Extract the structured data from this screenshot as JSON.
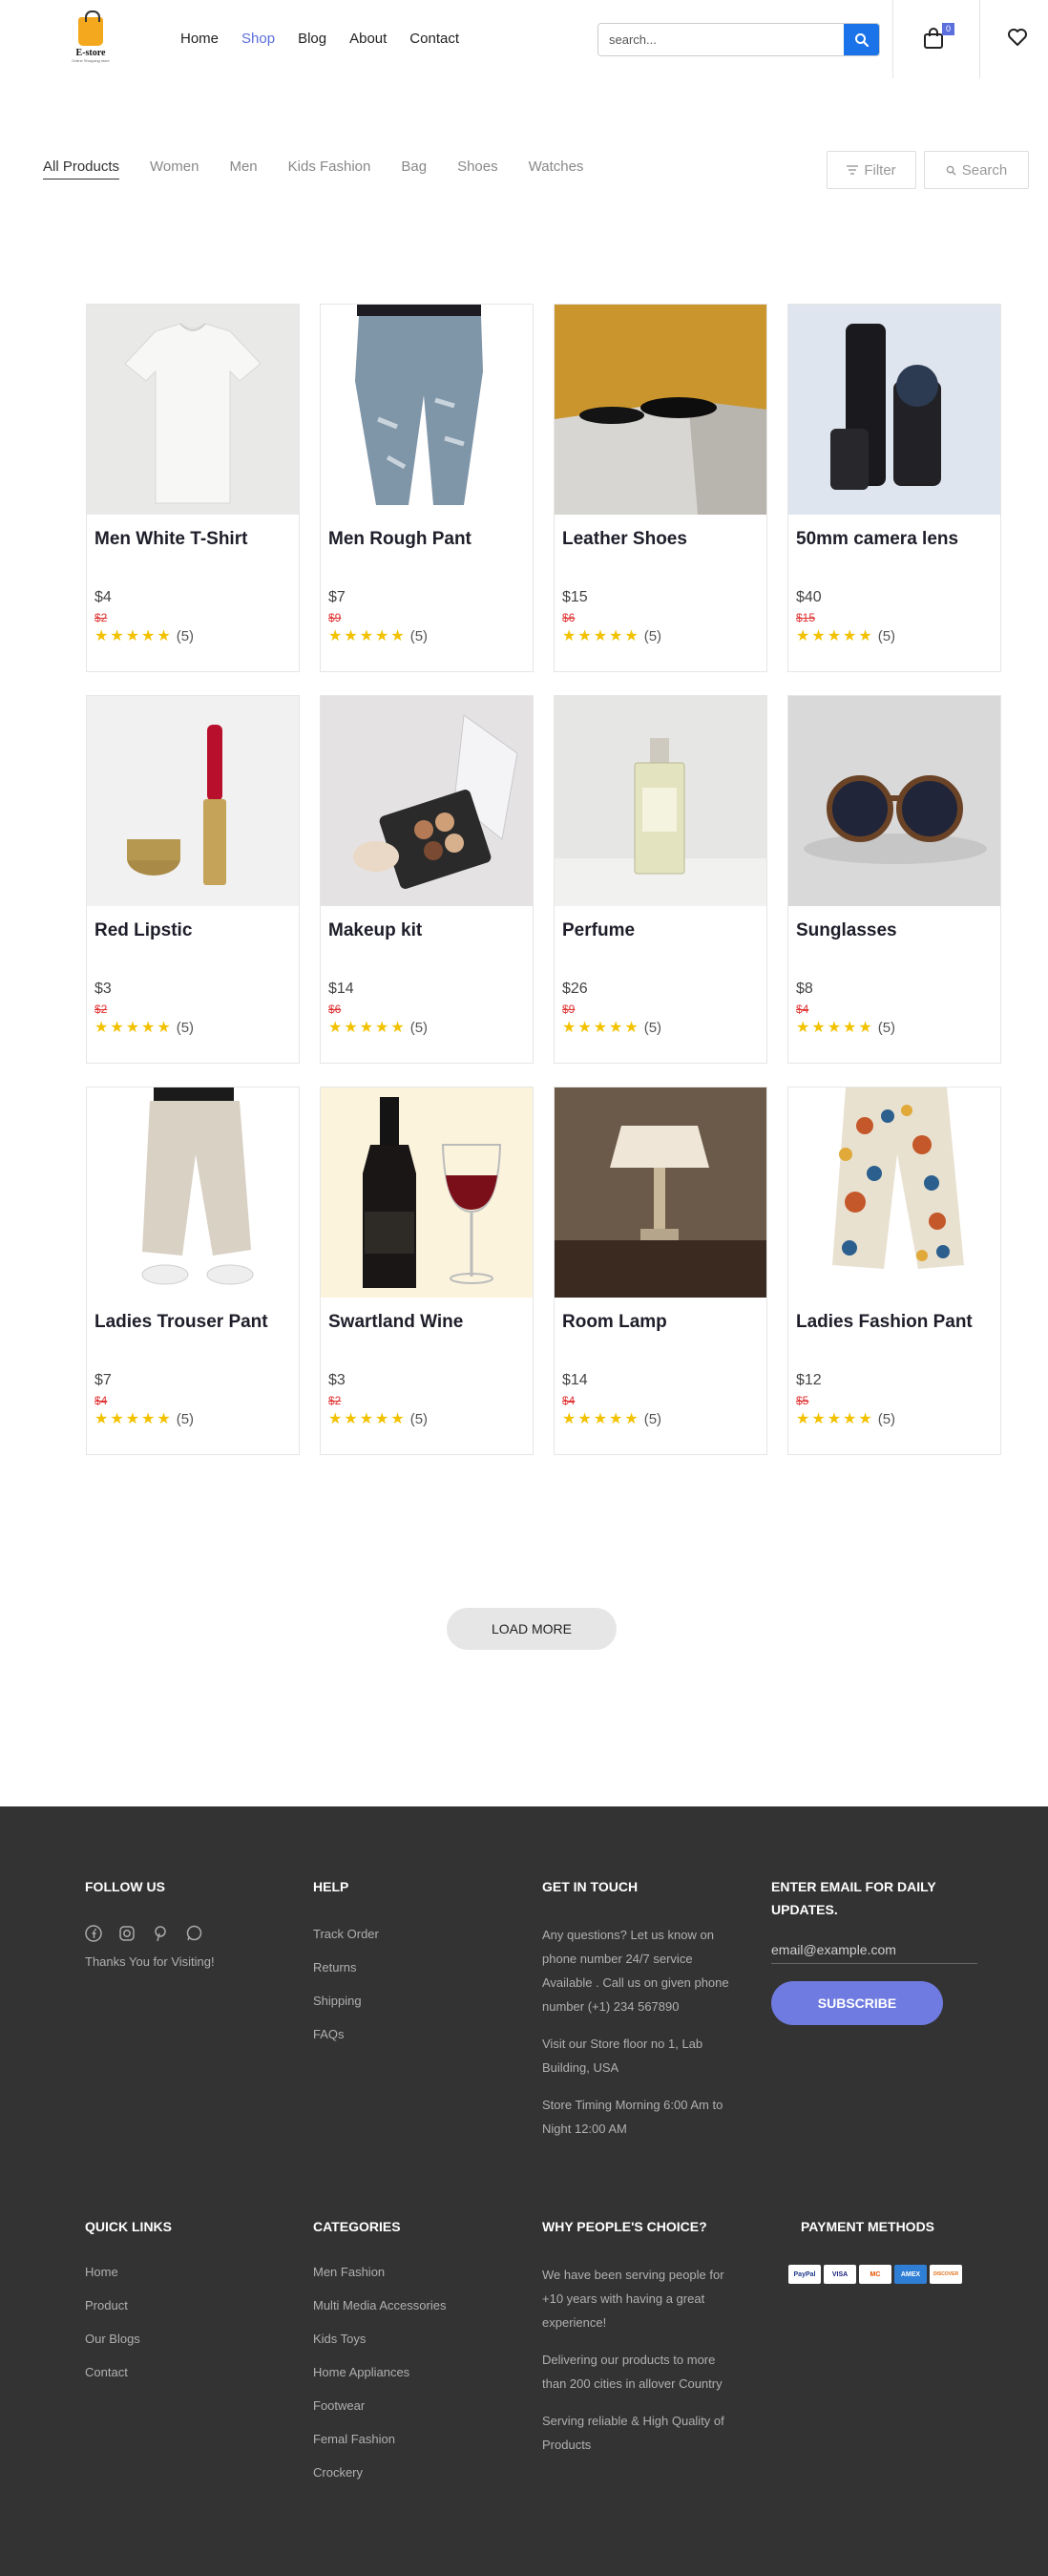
{
  "header": {
    "logo": {
      "brand": "E-store",
      "tagline": "Online Shopping store"
    },
    "nav": [
      "Home",
      "Shop",
      "Blog",
      "About",
      "Contact"
    ],
    "active_nav": "Shop",
    "search": {
      "placeholder": "search..."
    },
    "cart_count": "0"
  },
  "categories": {
    "items": [
      "All Products",
      "Women",
      "Men",
      "Kids Fashion",
      "Bag",
      "Shoes",
      "Watches"
    ],
    "active": "All Products",
    "filter_label": "Filter",
    "search_label": "Search"
  },
  "products": [
    {
      "name": "Men White T-Shirt",
      "price": "$4",
      "old_price": "$2",
      "rating": "(5)",
      "image": "white-tshirt"
    },
    {
      "name": "Men Rough Pant",
      "price": "$7",
      "old_price": "$9",
      "rating": "(5)",
      "image": "ripped-jeans"
    },
    {
      "name": "Leather Shoes",
      "price": "$15",
      "old_price": "$6",
      "rating": "(5)",
      "image": "leather-shoes"
    },
    {
      "name": "50mm camera lens",
      "price": "$40",
      "old_price": "$15",
      "rating": "(5)",
      "image": "camera-lens"
    },
    {
      "name": "Red Lipstic",
      "price": "$3",
      "old_price": "$2",
      "rating": "(5)",
      "image": "lipstick"
    },
    {
      "name": "Makeup kit",
      "price": "$14",
      "old_price": "$6",
      "rating": "(5)",
      "image": "makeup-kit"
    },
    {
      "name": "Perfume",
      "price": "$26",
      "old_price": "$9",
      "rating": "(5)",
      "image": "perfume"
    },
    {
      "name": "Sunglasses",
      "price": "$8",
      "old_price": "$4",
      "rating": "(5)",
      "image": "sunglasses"
    },
    {
      "name": "Ladies Trouser Pant",
      "price": "$7",
      "old_price": "$4",
      "rating": "(5)",
      "image": "trouser"
    },
    {
      "name": "Swartland Wine",
      "price": "$3",
      "old_price": "$2",
      "rating": "(5)",
      "image": "wine"
    },
    {
      "name": "Room Lamp",
      "price": "$14",
      "old_price": "$4",
      "rating": "(5)",
      "image": "lamp"
    },
    {
      "name": "Ladies Fashion Pant",
      "price": "$12",
      "old_price": "$5",
      "rating": "(5)",
      "image": "fashion-pant"
    }
  ],
  "load_more": "LOAD MORE",
  "footer": {
    "follow": {
      "title": "FOLLOW US",
      "thanks": "Thanks You for Visiting!"
    },
    "help": {
      "title": "HELP",
      "links": [
        "Track Order",
        "Returns",
        "Shipping",
        "FAQs"
      ]
    },
    "contact": {
      "title": "GET IN TOUCH",
      "lines1": [
        "Any questions? Let us know on",
        "phone number 24/7 service",
        "Available . Call us on given phone",
        "number (+1) 234 567890"
      ],
      "lines2": [
        "Visit our Store floor no 1, Lab",
        "Building, USA"
      ],
      "lines3": [
        "Store Timing Morning 6:00 Am to",
        "Night 12:00 AM"
      ]
    },
    "newsletter": {
      "title_line1": "ENTER EMAIL FOR DAILY",
      "title_line2": "UPDATES.",
      "placeholder": "email@example.com",
      "button": "SUBSCRIBE"
    },
    "quick_links": {
      "title": "QUICK LINKS",
      "links": [
        "Home",
        "Product",
        "Our Blogs",
        "Contact"
      ]
    },
    "categories": {
      "title": "CATEGORIES",
      "links": [
        "Men Fashion",
        "Multi Media Accessories",
        "Kids Toys",
        "Home Appliances",
        "Footwear",
        "Femal Fashion",
        "Crockery"
      ]
    },
    "why": {
      "title": "WHY PEOPLE'S CHOICE?",
      "lines1": [
        "We have been serving people for",
        "+10 years with having a great",
        "experience!"
      ],
      "lines2": [
        "Delivering our products to more",
        "than 200 cities in allover Country"
      ],
      "lines3": [
        "Serving reliable & High Quality of",
        "Products"
      ]
    },
    "payment": {
      "title": "PAYMENT METHODS",
      "cards": [
        "PayPal",
        "VISA",
        "MC",
        "AMEX",
        "DISCOVER"
      ]
    }
  }
}
